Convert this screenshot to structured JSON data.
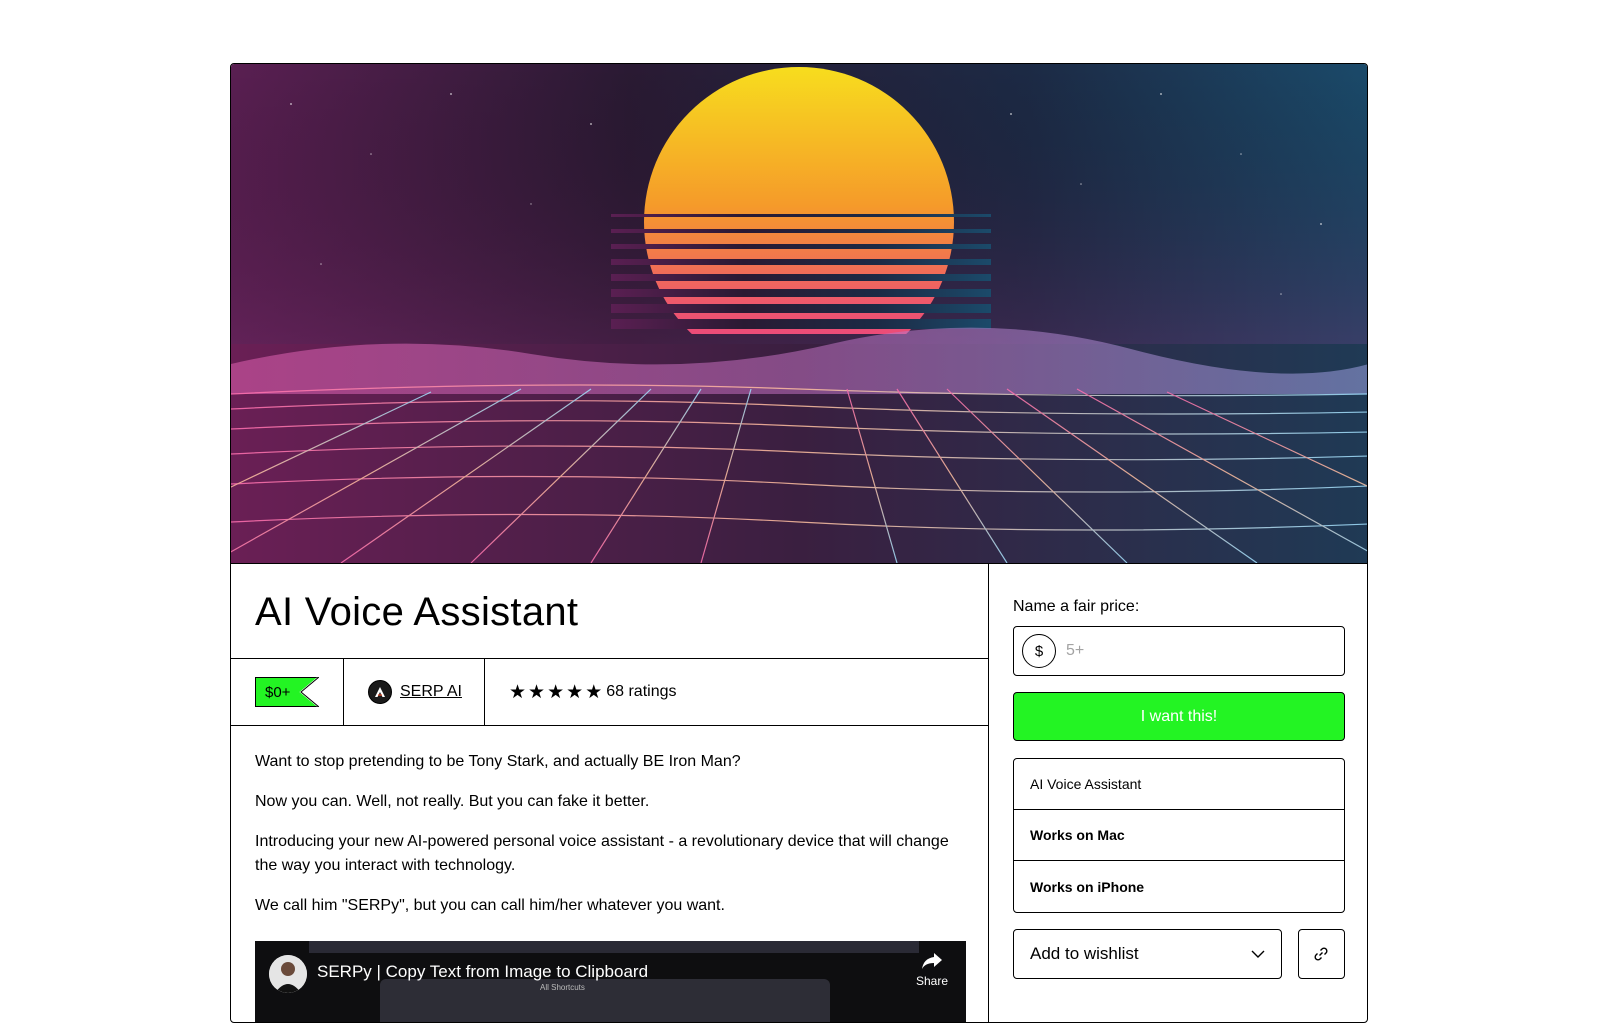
{
  "product": {
    "title": "AI Voice Assistant",
    "price_badge": "$0+",
    "seller_name": "SERP AI",
    "rating_count": "68 ratings",
    "rating_stars": 5
  },
  "description": {
    "paragraphs": [
      "Want to stop pretending to be Tony Stark, and actually BE Iron Man?",
      "Now you can. Well, not really. But you can fake it better.",
      "Introducing your new AI-powered personal voice assistant - a revolutionary device that will change the way you interact with technology.",
      "We call him \"SERPy\", but you can call him/her whatever you want."
    ]
  },
  "video": {
    "title": "SERPy | Copy Text from Image to Clipboard",
    "share_label": "Share",
    "window_title": "All Shortcuts"
  },
  "purchase": {
    "price_label": "Name a fair price:",
    "currency_symbol": "$",
    "price_placeholder": "5+",
    "buy_button": "I want this!",
    "info_rows": [
      "AI Voice Assistant",
      "Works on Mac",
      "Works on iPhone"
    ],
    "wishlist_label": "Add to wishlist"
  },
  "colors": {
    "accent_green": "#23f423",
    "border": "#000000"
  }
}
